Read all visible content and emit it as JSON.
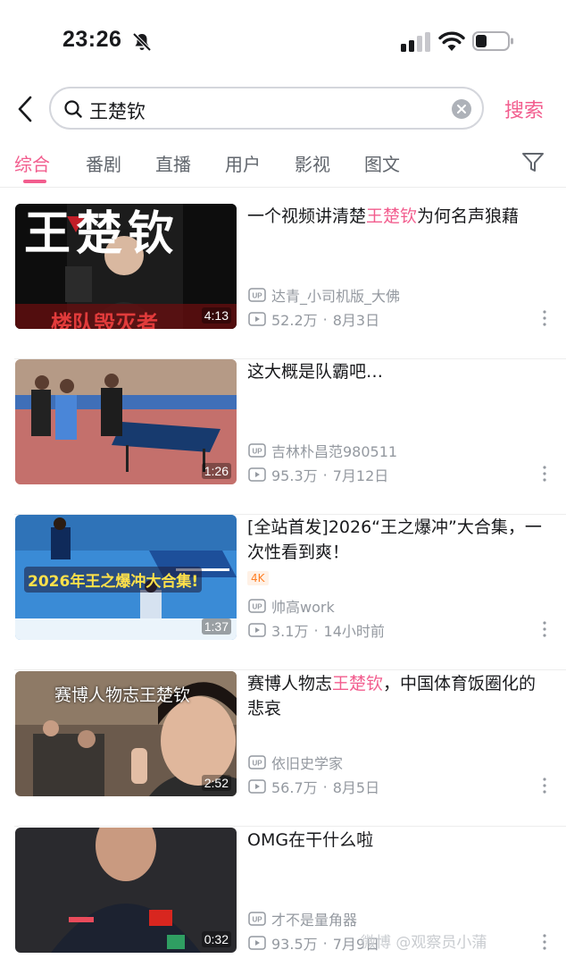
{
  "status_bar": {
    "time": "23:26"
  },
  "search": {
    "query": "王楚钦",
    "action_label": "搜索"
  },
  "tabs": [
    {
      "label": "综合",
      "active": true
    },
    {
      "label": "番剧"
    },
    {
      "label": "直播"
    },
    {
      "label": "用户"
    },
    {
      "label": "影视"
    },
    {
      "label": "图文"
    }
  ],
  "results": [
    {
      "title_parts": [
        "一个视频讲清楚",
        "王楚钦",
        "为何名声狼藉"
      ],
      "author": "达青_小司机版_大佛",
      "views": "52.2万",
      "date": "8月3日",
      "duration": "4:13",
      "thumb_text": "王楚钦",
      "thumb_subtext": "楼队毁灭者"
    },
    {
      "title_parts": [
        "这大概是队霸吧…"
      ],
      "author": "吉林朴昌范980511",
      "views": "95.3万",
      "date": "7月12日",
      "duration": "1:26"
    },
    {
      "title_parts": [
        "[全站首发]2026“王之爆冲”大合集，一次性看到爽！"
      ],
      "badge": "4K",
      "author": "帅高work",
      "views": "3.1万",
      "date": "14小时前",
      "duration": "1:37",
      "thumb_text": "2026年王之爆冲大合集!"
    },
    {
      "title_parts": [
        "赛博人物志",
        "王楚钦",
        "，中国体育饭圈化的悲哀"
      ],
      "author": "依旧史学家",
      "views": "56.7万",
      "date": "8月5日",
      "duration": "2:52",
      "thumb_text": "赛博人物志王楚钦"
    },
    {
      "title_parts": [
        "OMG在干什么啦"
      ],
      "author": "才不是量角器",
      "views": "93.5万",
      "date": "7月9日",
      "duration": "0:32"
    }
  ],
  "watermark": "微博 @观察员小蒲",
  "colors": {
    "accent": "#f25d8e",
    "meta": "#9499a0",
    "text": "#18191c"
  }
}
